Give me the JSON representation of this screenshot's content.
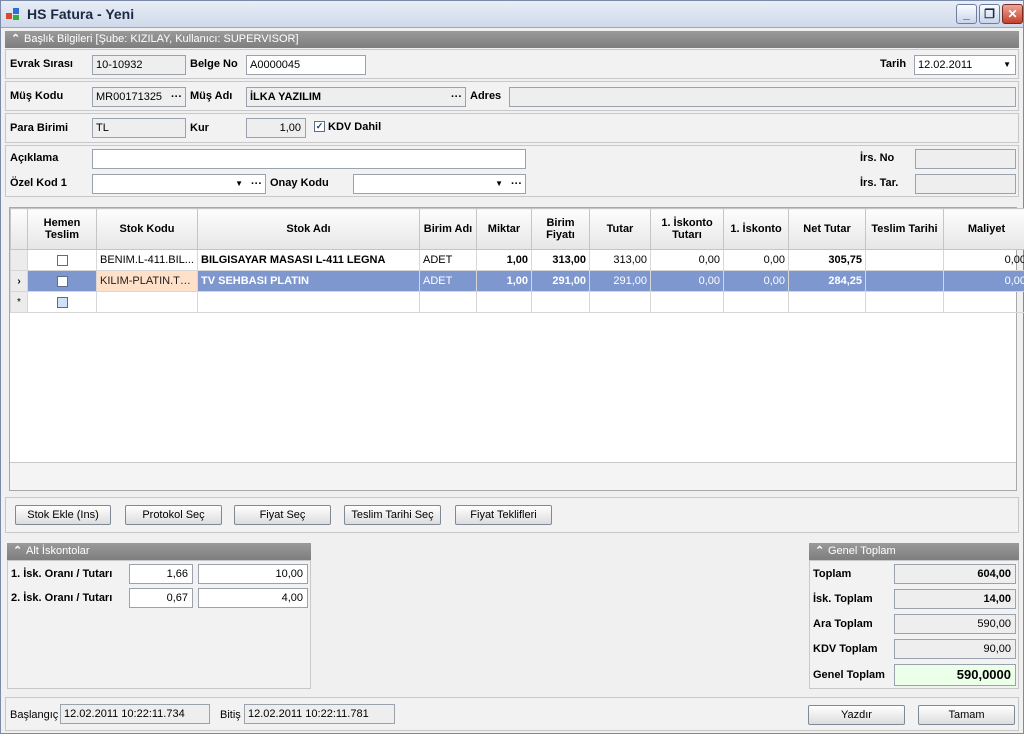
{
  "window": {
    "title": "HS Fatura - Yeni",
    "controls": [
      "_",
      "❐",
      "✕"
    ]
  },
  "header_group": {
    "title": "Başlık Bilgileri [Şube: KIZILAY, Kullanıcı: SUPERVISOR]"
  },
  "header": {
    "evrak_sirasi_label": "Evrak Sırası",
    "evrak_sirasi": "10-10932",
    "belge_no_label": "Belge No",
    "belge_no": "A0000045",
    "tarih_label": "Tarih",
    "tarih": "12.02.2011",
    "mus_kodu_label": "Müş Kodu",
    "mus_kodu": "MR00171325",
    "mus_adi_label": "Müş Adı",
    "mus_adi": "İLKA YAZILIM",
    "adres_label": "Adres",
    "adres": "",
    "para_birimi_label": "Para Birimi",
    "para_birimi": "TL",
    "kur_label": "Kur",
    "kur": "1,00",
    "kdv_dahil_label": "KDV Dahil",
    "kdv_dahil_checked": true,
    "aciklama_label": "Açıklama",
    "aciklama": "",
    "irs_no_label": "İrs. No",
    "irs_no": "",
    "ozel_kod_label": "Özel Kod 1",
    "ozel_kod": "",
    "onay_kodu_label": "Onay Kodu",
    "onay_kodu": "",
    "irs_tar_label": "İrs. Tar.",
    "irs_tar": ""
  },
  "grid": {
    "columns": [
      "Hemen Teslim",
      "Stok Kodu",
      "Stok Adı",
      "Birim Adı",
      "Miktar",
      "Birim Fiyatı",
      "Tutar",
      "1. İskonto Tutarı",
      "1. İskonto",
      "Net Tutar",
      "Teslim Tarihi",
      "Maliyet"
    ],
    "rows": [
      {
        "indicator": "",
        "stok_kodu": "BENIM.L-411.BIL...",
        "stok_adi": "BILGISAYAR MASASI L-411 LEGNA",
        "birim": "ADET",
        "miktar": "1,00",
        "birim_fiyati": "313,00",
        "tutar": "313,00",
        "isk_tutar": "0,00",
        "isk": "0,00",
        "net_tutar": "305,75",
        "teslim_tarihi": "",
        "maliyet": "0,00"
      },
      {
        "indicator": "›",
        "stok_kodu": "KILIM-PLATIN.TV...",
        "stok_adi": "TV SEHBASI PLATIN",
        "birim": "ADET",
        "miktar": "1,00",
        "birim_fiyati": "291,00",
        "tutar": "291,00",
        "isk_tutar": "0,00",
        "isk": "0,00",
        "net_tutar": "284,25",
        "teslim_tarihi": "",
        "maliyet": "0,00"
      }
    ],
    "new_row_indicator": "*"
  },
  "actions": {
    "stok_ekle": "Stok Ekle (Ins)",
    "protokol_sec": "Protokol Seç",
    "fiyat_sec": "Fiyat Seç",
    "teslim_tarihi_sec": "Teslim Tarihi Seç",
    "fiyat_teklifleri": "Fiyat Teklifleri"
  },
  "alt_iskontolar": {
    "title": "Alt İskontolar",
    "row1_label": "1. İsk. Oranı / Tutarı",
    "row1_oran": "1,66",
    "row1_tutar": "10,00",
    "row2_label": "2. İsk. Oranı / Tutarı",
    "row2_oran": "0,67",
    "row2_tutar": "4,00"
  },
  "genel_toplam": {
    "title": "Genel Toplam",
    "toplam_label": "Toplam",
    "toplam": "604,00",
    "isk_toplam_label": "İsk. Toplam",
    "isk_toplam": "14,00",
    "ara_toplam_label": "Ara Toplam",
    "ara_toplam": "590,00",
    "kdv_toplam_label": "KDV Toplam",
    "kdv_toplam": "90,00",
    "genel_toplam_label": "Genel Toplam",
    "genel_toplam": "590,0000"
  },
  "footer": {
    "baslangic_label": "Başlangıç",
    "baslangic": "12.02.2011 10:22:11.734",
    "bitis_label": "Bitiş",
    "bitis": "12.02.2011 10:22:11.781",
    "yazdir": "Yazdır",
    "tamam": "Tamam"
  },
  "colors": {
    "selected_row": "#7f97cf",
    "highlight_cell": "#ffe0c8",
    "total_highlight": "#ecffe8"
  }
}
